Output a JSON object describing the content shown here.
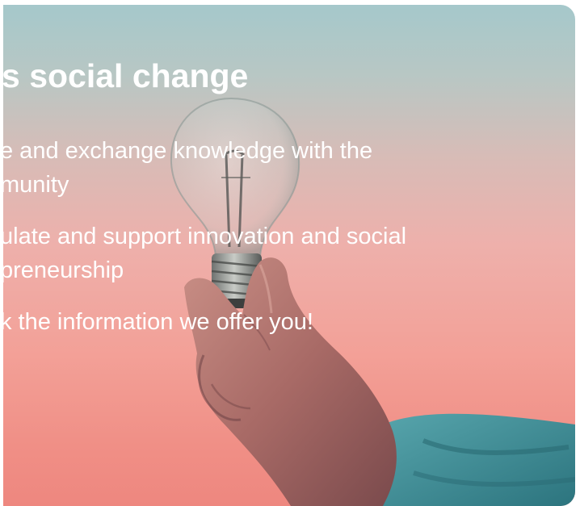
{
  "hero": {
    "heading": "s social change",
    "bullets": [
      {
        "line1": "e and exchange knowledge with the",
        "line2": "munity"
      },
      {
        "line1": "ulate and support innovation and social",
        "line2": "preneurship"
      },
      {
        "line1": "k the information we offer you!",
        "line2": ""
      }
    ]
  },
  "colors": {
    "sky_top": "#a5c8cb",
    "sky_bottom": "#ee877f",
    "sleeve": "#3e8a93",
    "text": "#ffffff"
  },
  "icons": {
    "photo": "hand-holding-light-bulb-image"
  }
}
